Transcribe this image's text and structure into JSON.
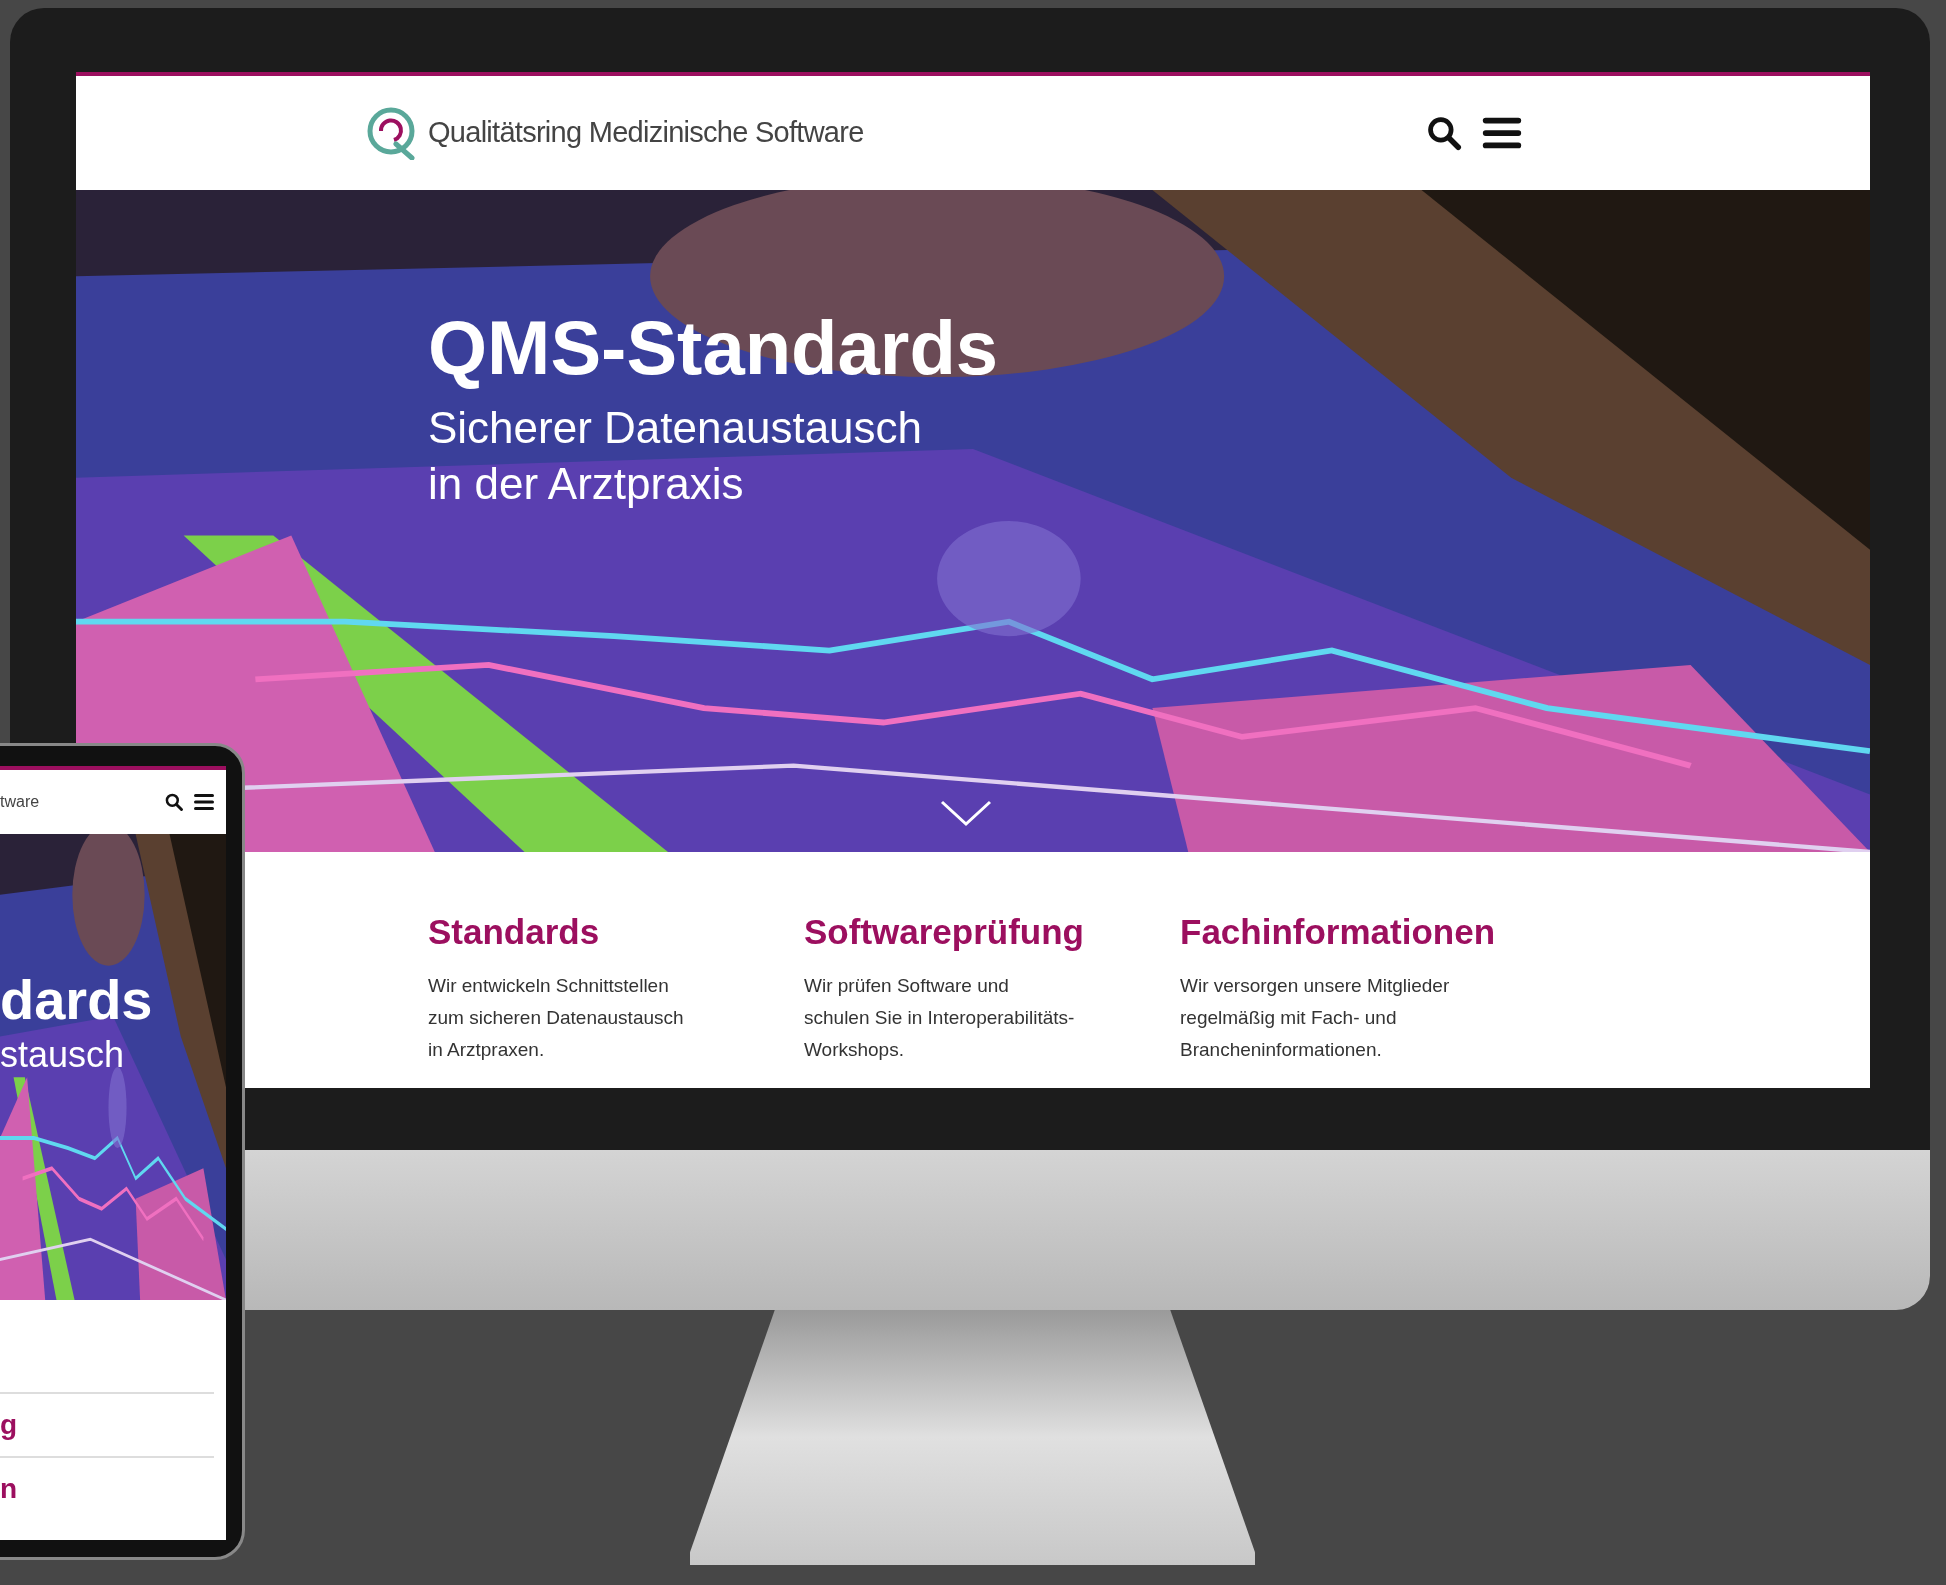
{
  "site": {
    "name": "Qualitätsring Medizinische Software"
  },
  "hero": {
    "title": "QMS-Standards",
    "subtitle_lines": [
      "Sicherer Datenaustausch",
      "in der Arztpraxis"
    ]
  },
  "features": [
    {
      "title": "Standards",
      "text": "Wir entwickeln Schnittstellen\nzum sicheren Datenaustausch\nin Arztpraxen."
    },
    {
      "title": "Softwareprüfung",
      "text": "Wir prüfen Software und\nschulen Sie in Interoperabilitäts-\nWorkshops."
    },
    {
      "title": "Fachinformationen",
      "text": "Wir versorgen unsere Mitglieder\nregelmäßig mit Fach- und\nBrancheninformationen."
    }
  ],
  "phone": {
    "site_name": "tware",
    "hero_title": "dards",
    "hero_subtitle": "stausch",
    "menu_items": [
      "g",
      "n"
    ]
  }
}
